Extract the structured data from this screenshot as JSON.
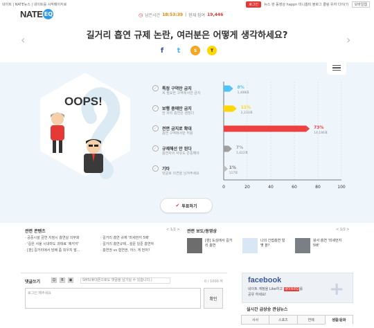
{
  "topbar": {
    "left_links": "네이트 | NATE뉴스 | 내이트를 시작페이지로",
    "login": "로그인",
    "right_links": "뉴스  판  동영상  happn  미니홈피  블로그  쿨링  유저  다이(?)",
    "more": "모바일웹"
  },
  "logo": {
    "brand": "NATE",
    "badge": "EQ"
  },
  "meta": {
    "clock_label": "남은시간",
    "time": "18:53:39",
    "part_label": "현재 참여",
    "participants": "19,446"
  },
  "question": "길거리 흡연 규제 논란, 여러분은 어떻게 생각하세요?",
  "share": {
    "facebook": "f",
    "twitter": "t",
    "kakaostory": "S",
    "kakaotalk": "T"
  },
  "illustration": {
    "speech": "OOPS!"
  },
  "options": [
    {
      "title": "특정 구역만 금지",
      "sub": "꼭 필요한 구역에서만 금지",
      "percent": 8,
      "votes": "1,488표",
      "color": "#4fc3f7"
    },
    {
      "title": "보행 중에만 금지",
      "sub": "한 자리 흡연은 괜찮다",
      "percent": 11,
      "votes": "2,233표",
      "color": "#ffd600"
    },
    {
      "title": "전면 금지로 확대",
      "sub": "흡연 구역에서만 허용",
      "percent": 73,
      "votes": "14,186표",
      "color": "#ef4040"
    },
    {
      "title": "규제해선 안 된다",
      "sub": "흡연자의 자유도 존중해야",
      "percent": 7,
      "votes": "1,422표",
      "color": "#9e9e9e"
    },
    {
      "title": "기타",
      "sub": "댓글로 의견을 남겨주세요",
      "percent": 1,
      "votes": "117표",
      "color": "#bdbdbd"
    }
  ],
  "chart_data": {
    "type": "bar",
    "orientation": "horizontal",
    "categories": [
      "특정 구역만 금지",
      "보행 중에만 금지",
      "전면 금지로 확대",
      "규제해선 안 된다",
      "기타"
    ],
    "values": [
      8,
      11,
      73,
      7,
      1
    ],
    "value_labels": [
      "8%",
      "11%",
      "73%",
      "7%",
      "1%"
    ],
    "vote_labels": [
      "1,488표",
      "2,233표",
      "14,186표",
      "1,422표",
      "117표"
    ],
    "xticks": [
      "0",
      "20",
      "40",
      "60",
      "80",
      "100"
    ],
    "xlim": [
      0,
      100
    ]
  },
  "vote_button": "투표하기",
  "related": {
    "title": "관련 콘텐츠",
    "col1": [
      "· 공중시설 금연 지정시 흡연실 의무화",
      "· '길은 서울 시내마도 과태료 '제각각'",
      "· [판] 길거리에서 담배 좀 피우지 말..."
    ],
    "col2": [
      "· 길거리 흡연 규제 '마세먼지 5배'",
      "· 길거리 흡연규제...설문 일준 흡연자",
      "· 흡연권 vs 혐연권, 어느 게 먼저?"
    ],
    "nav": "< 1/2 >",
    "news_title": "관련 보도/동영상",
    "news_nav": "< 1/2 >",
    "thumbs": [
      "[판] 도심에서 길거리 흡연",
      "나의 간접흡연 얼 몇 분?",
      "왕사 흡연 '미세먼지 5배'"
    ]
  },
  "comments": {
    "title": "댓글쓰기",
    "sms_placeholder": "SMS(휴대폰으로도 댓글을 남기실 수 있습니다.)",
    "count": "0 / 1000 자",
    "input_placeholder": "로그인 해주세요",
    "submit": "확인"
  },
  "facebook": {
    "title": "facebook",
    "desc1": "네이트 계정을 Like하고",
    "highlight": "네이트EQ",
    "desc2": "를",
    "desc3": "공유 하세요!"
  },
  "realtime": {
    "title": "실시간 급상승 관심뉴스",
    "tabs": [
      "사사",
      "스포츠",
      "연예",
      "생활/문화"
    ]
  }
}
